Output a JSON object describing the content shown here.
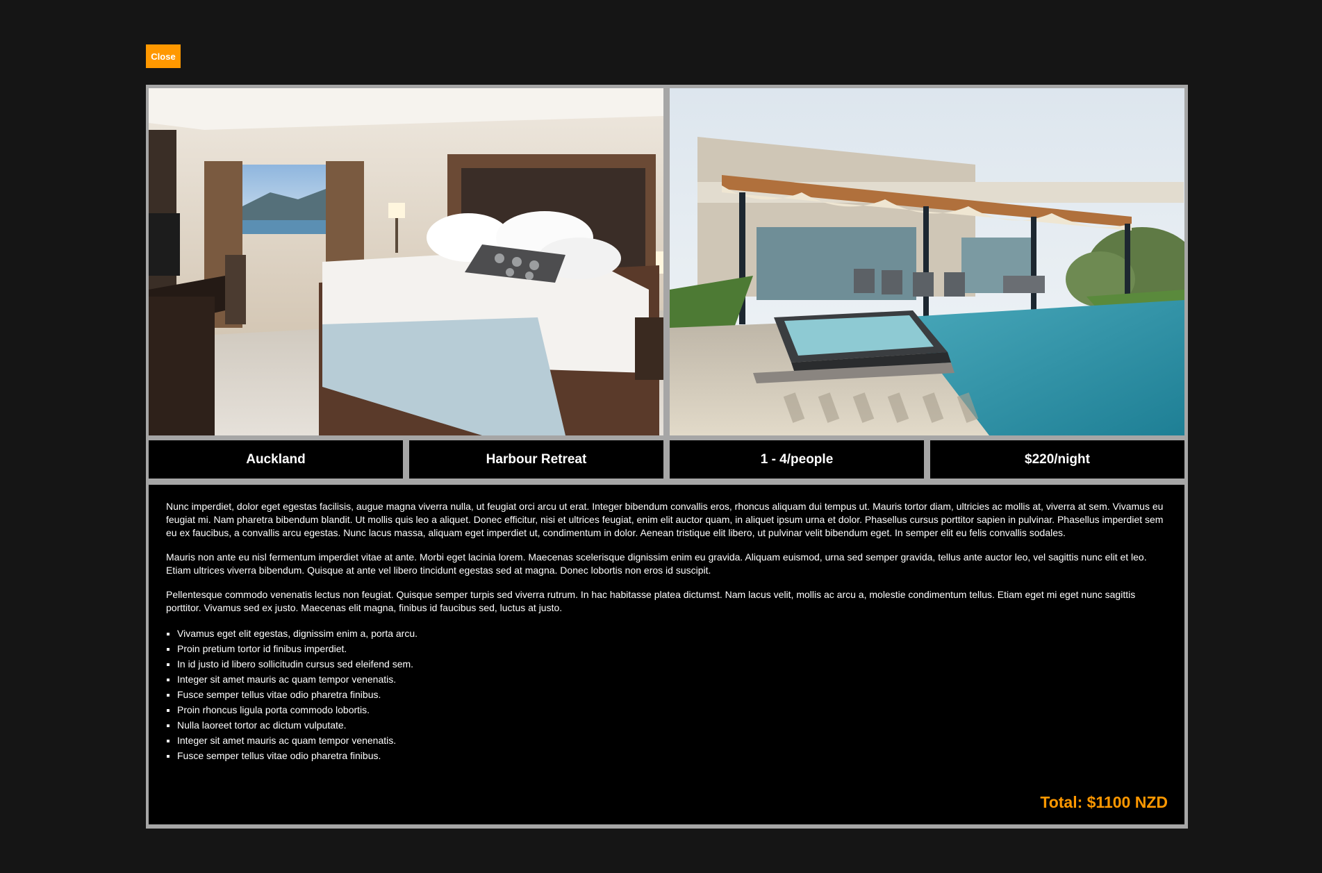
{
  "close_label": "Close",
  "accent_color": "#ff9800",
  "photos": [
    {
      "name": "hotel-bedroom"
    },
    {
      "name": "villa-pool"
    }
  ],
  "info": {
    "location": "Auckland",
    "property": "Harbour Retreat",
    "capacity": "1 - 4/people",
    "price": "$220/night"
  },
  "description": {
    "paragraphs": [
      "Nunc imperdiet, dolor eget egestas facilisis, augue magna viverra nulla, ut feugiat orci arcu ut erat. Integer bibendum convallis eros, rhoncus aliquam dui tempus ut. Mauris tortor diam, ultricies ac mollis at, viverra at sem. Vivamus eu feugiat mi. Nam pharetra bibendum blandit. Ut mollis quis leo a aliquet. Donec efficitur, nisi et ultrices feugiat, enim elit auctor quam, in aliquet ipsum urna et dolor. Phasellus cursus porttitor sapien in pulvinar. Phasellus imperdiet sem eu ex faucibus, a convallis arcu egestas. Nunc lacus massa, aliquam eget imperdiet ut, condimentum in dolor. Aenean tristique elit libero, ut pulvinar velit bibendum eget. In semper elit eu felis convallis sodales.",
      "Mauris non ante eu nisl fermentum imperdiet vitae at ante. Morbi eget lacinia lorem. Maecenas scelerisque dignissim enim eu gravida. Aliquam euismod, urna sed semper gravida, tellus ante auctor leo, vel sagittis nunc elit et leo. Etiam ultrices viverra bibendum. Quisque at ante vel libero tincidunt egestas sed at magna. Donec lobortis non eros id suscipit.",
      "Pellentesque commodo venenatis lectus non feugiat. Quisque semper turpis sed viverra rutrum. In hac habitasse platea dictumst. Nam lacus velit, mollis ac arcu a, molestie condimentum tellus. Etiam eget mi eget nunc sagittis porttitor. Vivamus sed ex justo. Maecenas elit magna, finibus id faucibus sed, luctus at justo."
    ],
    "list": [
      "Vivamus eget elit egestas, dignissim enim a, porta arcu.",
      "Proin pretium tortor id finibus imperdiet.",
      "In id justo id libero sollicitudin cursus sed eleifend sem.",
      "Integer sit amet mauris ac quam tempor venenatis.",
      "Fusce semper tellus vitae odio pharetra finibus.",
      "Proin rhoncus ligula porta commodo lobortis.",
      "Nulla laoreet tortor ac dictum vulputate.",
      "Integer sit amet mauris ac quam tempor venenatis.",
      "Fusce semper tellus vitae odio pharetra finibus."
    ]
  },
  "total": "Total: $1100 NZD"
}
